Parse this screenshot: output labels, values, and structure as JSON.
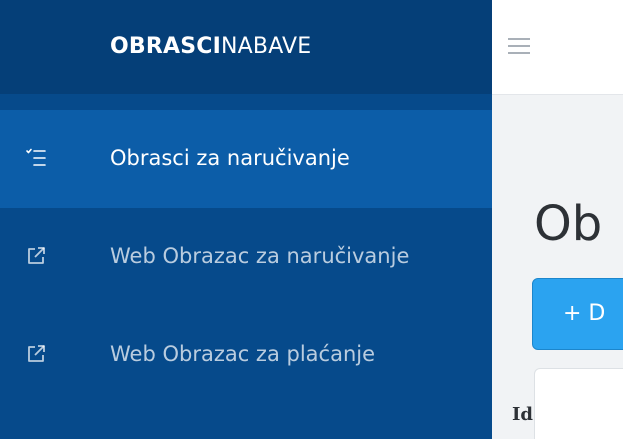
{
  "brand": {
    "bold": "OBRASCI",
    "light": "NABAVE"
  },
  "sidebar": {
    "items": [
      {
        "label": "Obrasci za naručivanje",
        "icon": "checklist-icon",
        "active": true
      },
      {
        "label": "Web Obrazac za naručivanje",
        "icon": "external-link-icon",
        "active": false
      },
      {
        "label": "Web Obrazac za plaćanje",
        "icon": "external-link-icon",
        "active": false
      }
    ]
  },
  "topbar": {
    "menu_icon": "hamburger-menu-icon"
  },
  "main": {
    "title": "Ob",
    "add_button_label": "+ D",
    "table": {
      "columns": [
        "Id"
      ]
    }
  },
  "colors": {
    "sidebar_bg": "#064a8b",
    "brand_bg": "#053f78",
    "active_item_bg": "#0c5da8",
    "primary_button": "#2ba3f0",
    "main_bg": "#f1f3f5"
  }
}
